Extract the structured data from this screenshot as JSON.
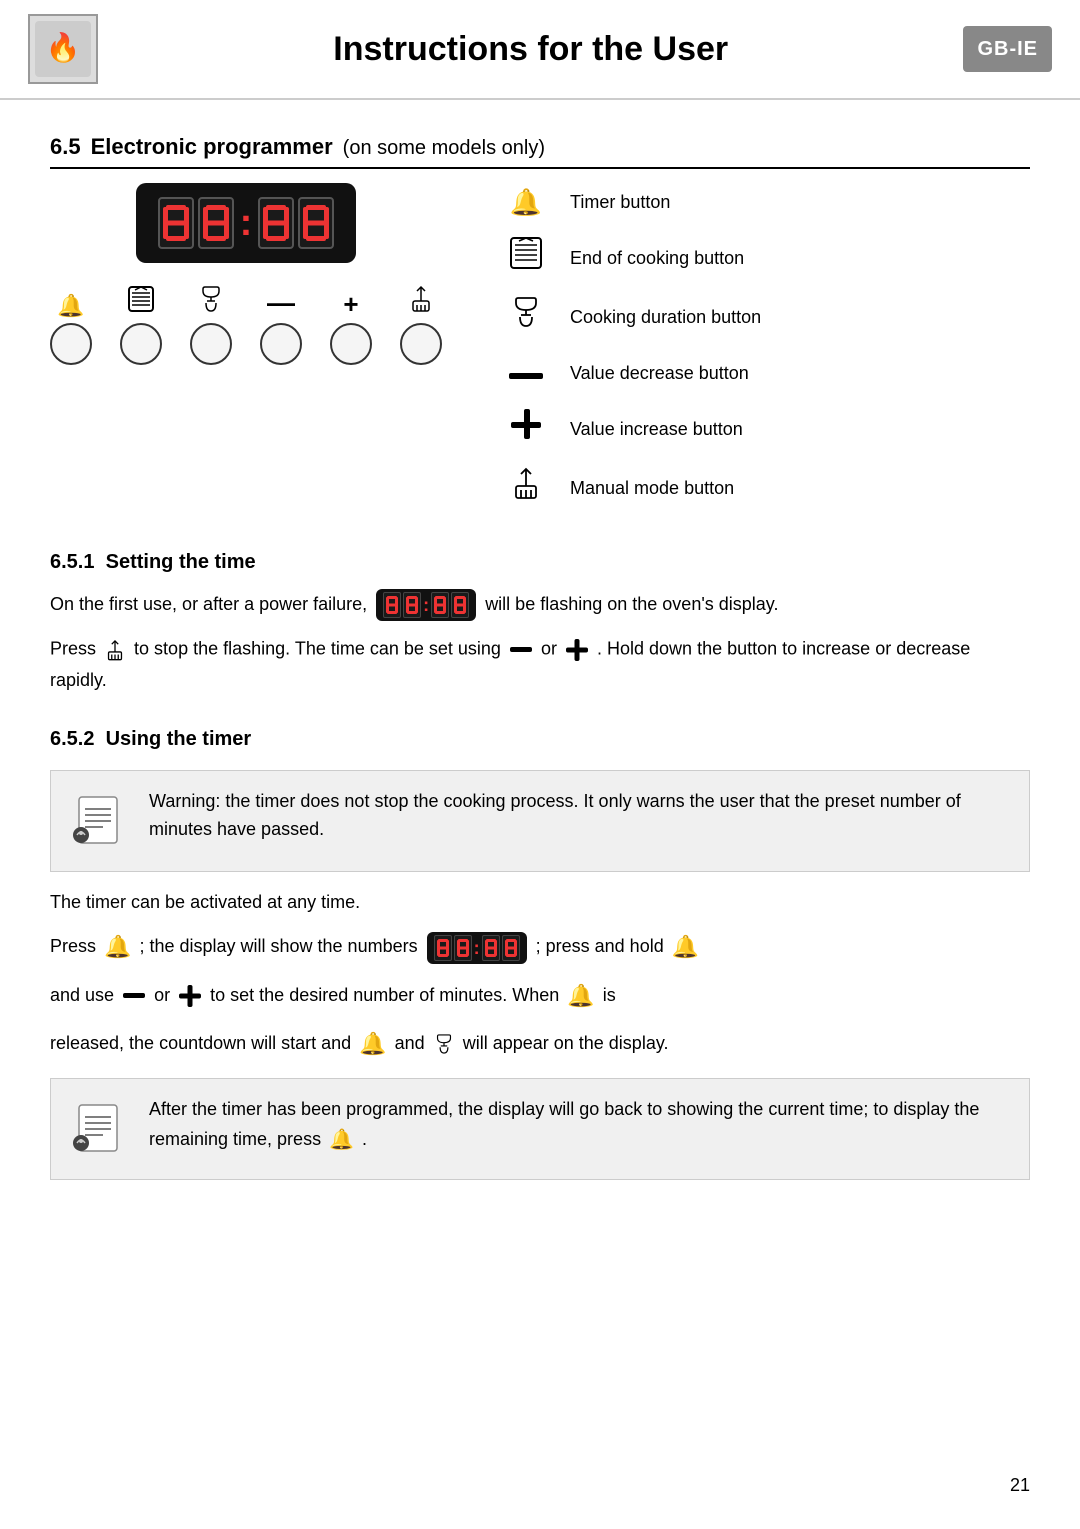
{
  "header": {
    "title": "Instructions for the User",
    "badge": "GB-IE"
  },
  "section": {
    "number": "6.5",
    "title": "Electronic programmer",
    "subtitle": "(on some models only)"
  },
  "legend": {
    "items": [
      {
        "id": "timer-button",
        "label": "Timer button"
      },
      {
        "id": "end-cooking-button",
        "label": "End of cooking button"
      },
      {
        "id": "cooking-duration-button",
        "label": "Cooking duration button"
      },
      {
        "id": "value-decrease-button",
        "label": "Value decrease button"
      },
      {
        "id": "value-increase-button",
        "label": "Value increase button"
      },
      {
        "id": "manual-mode-button",
        "label": "Manual mode button"
      }
    ]
  },
  "subsections": {
    "s651": {
      "number": "6.5.1",
      "title": "Setting the time",
      "para1": "On the first use, or after a power failure,",
      "para1b": "will be flashing on the oven's display.",
      "para2a": "Press",
      "para2b": "to stop the flashing. The time can be set using",
      "para2c": "or",
      "para2d": ". Hold down the button to increase or decrease rapidly."
    },
    "s652": {
      "number": "6.5.2",
      "title": "Using the timer",
      "warning1": "Warning: the timer does not stop the cooking process. It only warns the user that the preset number of minutes have passed.",
      "para_timer": "The timer can be activated at any time.",
      "press_line_a": "Press",
      "press_line_b": "; the display will show the numbers",
      "press_line_c": "; press and hold",
      "line2_a": "and use",
      "line2_b": "or",
      "line2_c": "to set the desired number of minutes. When",
      "line2_d": "is",
      "line3_a": "released, the countdown will start and",
      "line3_b": "and",
      "line3_c": "will appear on the display.",
      "warning2": "After the timer has been programmed, the display will go back to showing the current time; to display the remaining time, press",
      "warning2b": "."
    }
  },
  "page_number": "21"
}
